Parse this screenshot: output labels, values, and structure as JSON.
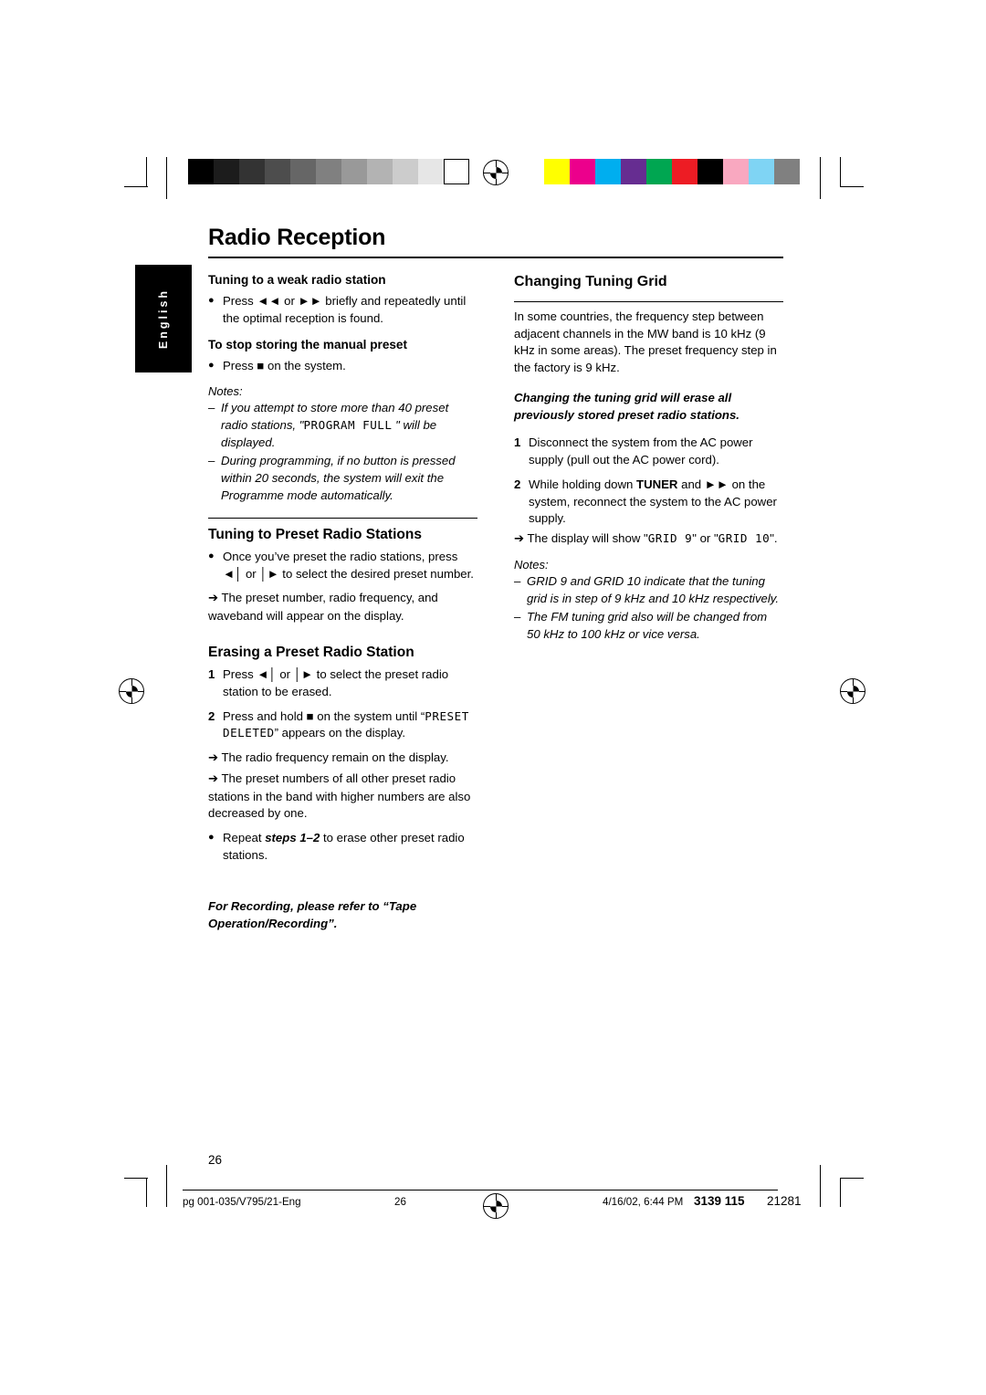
{
  "document": {
    "title": "Radio Reception",
    "side_tab": "English",
    "page_number": "26"
  },
  "left_column": {
    "weak_station": {
      "heading": "Tuning to a weak radio station",
      "bullet": "Press ◄◄ or ►► briefly and repeatedly until the optimal reception is found."
    },
    "stop_storing": {
      "heading": "To stop storing the manual preset",
      "bullet": "Press ■ on the system."
    },
    "notes_label": "Notes:",
    "notes": [
      "If you attempt to store more than 40 preset radio stations, \"PROGRAM FULL \" will be displayed.",
      "During programming, if no button is pressed within 20 seconds, the system will exit the Programme mode automatically."
    ],
    "notes_lcd": "PROGRAM FULL",
    "preset_tuning": {
      "heading": "Tuning to Preset Radio Stations",
      "bullet": "Once you’ve preset the radio stations, press ◄│ or │► to select the desired preset number.",
      "arrow": "The preset number, radio frequency, and waveband will appear on the display."
    },
    "erasing": {
      "heading": "Erasing a Preset Radio Station",
      "steps": [
        {
          "num": "1",
          "text": "Press ◄│ or │► to select the preset radio station to be erased."
        },
        {
          "num": "2",
          "text": "Press and hold ■ on the system until “PRESET DELETED” appears on the display.",
          "lcd1": "PRESET",
          "lcd2": "DELETED"
        }
      ],
      "arrows": [
        "The radio frequency remain on the display.",
        "The preset numbers of all other preset radio stations in the band with higher numbers are also decreased by one."
      ],
      "repeat_bullet_pre": "Repeat ",
      "repeat_bullet_bold": "steps 1–2",
      "repeat_bullet_post": " to erase other preset radio stations."
    },
    "closing_note": "For Recording, please refer to “Tape Operation/Recording”."
  },
  "right_column": {
    "heading": "Changing Tuning Grid",
    "intro": "In some countries, the frequency step between adjacent channels in the MW band is 10 kHz (9 kHz in some areas). The preset frequency step in the factory is 9 kHz.",
    "warning": "Changing the tuning grid will erase all previously stored preset radio stations.",
    "steps": [
      {
        "num": "1",
        "text": "Disconnect the system from the AC power supply (pull out the AC power cord)."
      },
      {
        "num": "2",
        "text_pre": "While holding down ",
        "text_bold": "TUNER",
        "text_mid": " and ►► on the system, reconnect the system to the AC power supply."
      }
    ],
    "display_arrow_pre": "The display will show \"",
    "display_lcd1": "GRID 9",
    "display_arrow_mid": "\" or \"",
    "display_lcd2": "GRID 10",
    "display_arrow_post": "\".",
    "notes_label": "Notes:",
    "notes": [
      "GRID 9 and GRID 10 indicate that the tuning grid is in step of 9 kHz and 10 kHz respectively.",
      "The FM tuning grid also will be changed from 50 kHz to 100 kHz or vice versa."
    ]
  },
  "footer": {
    "left": "pg 001-035/V795/21-Eng",
    "mid": "26",
    "date": "4/16/02, 6:44 PM",
    "code_bold": "3139 115",
    "code_rest": "21281"
  },
  "print_marks": {
    "grayscale_swatches": [
      "#000000",
      "#1c1c1c",
      "#333333",
      "#4d4d4d",
      "#666666",
      "#808080",
      "#999999",
      "#b3b3b3",
      "#cccccc",
      "#e6e6e6",
      "#ffffff"
    ],
    "color_swatches": [
      "#ffff00",
      "#ec008c",
      "#00aeef",
      "#662d91",
      "#00a651",
      "#ed1c24",
      "#000000",
      "#f9a8c0",
      "#7fd4f4",
      "#808080"
    ]
  }
}
